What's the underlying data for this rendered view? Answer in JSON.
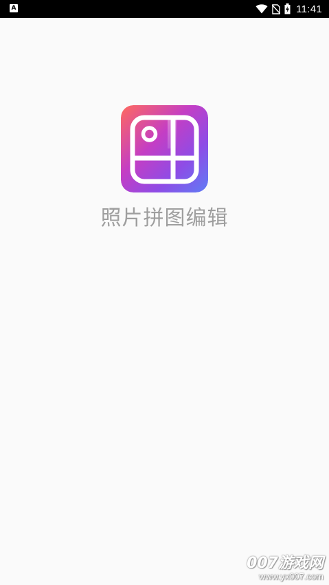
{
  "status_bar": {
    "left_icon_name": "a-notification-icon",
    "left_icon_glyph": "A",
    "time": "11:41",
    "icons": [
      "wifi-icon",
      "no-sim-icon",
      "battery-charging-icon"
    ]
  },
  "splash": {
    "app_name": "照片拼图编辑",
    "icon_name": "photo-collage-app-icon",
    "icon_gradient": [
      "#ff6a5e",
      "#c43ec4",
      "#8e4ce6",
      "#5f7cf5"
    ]
  },
  "watermark": {
    "brand": "007游戏网",
    "url": "www.yx007.com"
  }
}
